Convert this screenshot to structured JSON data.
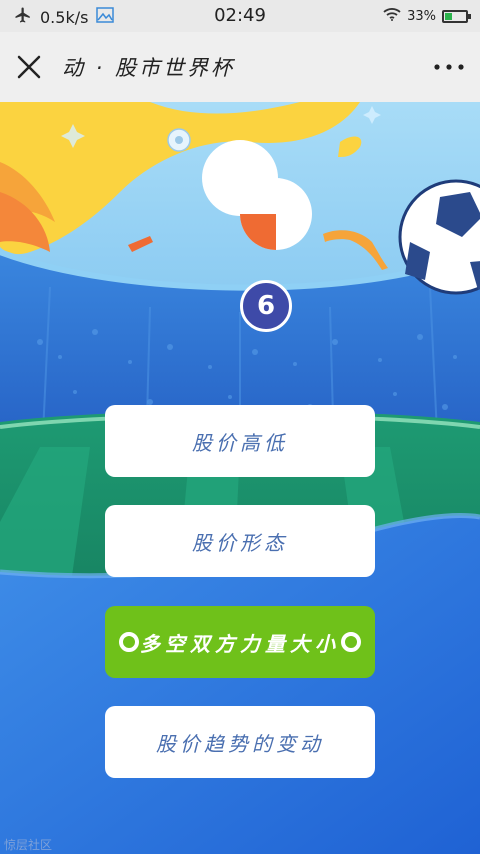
{
  "status_bar": {
    "speed": "0.5k/s",
    "time": "02:49",
    "battery": "33%",
    "icons": [
      "airplane-icon",
      "image-icon",
      "wifi-icon",
      "battery-icon"
    ],
    "battery_level": 0.33
  },
  "header": {
    "title": "动 · 股市世界杯",
    "close_icon": "close-icon",
    "more_icon": "more-icon"
  },
  "quiz": {
    "counter": "6",
    "options": [
      {
        "label": "股价高低",
        "selected": false
      },
      {
        "label": "股价形态",
        "selected": false
      },
      {
        "label": "多空双方力量大小",
        "selected": true
      },
      {
        "label": "股价趋势的变动",
        "selected": false
      }
    ]
  },
  "footer": {
    "watermark": "惊层社区"
  },
  "colors": {
    "sky": "#9fd6f5",
    "stadium": "#2f7ad8",
    "field": "#1e8f6a",
    "selected": "#6fc11a",
    "option_text": "#4a6fb0",
    "counter": "#3e4aa8"
  }
}
